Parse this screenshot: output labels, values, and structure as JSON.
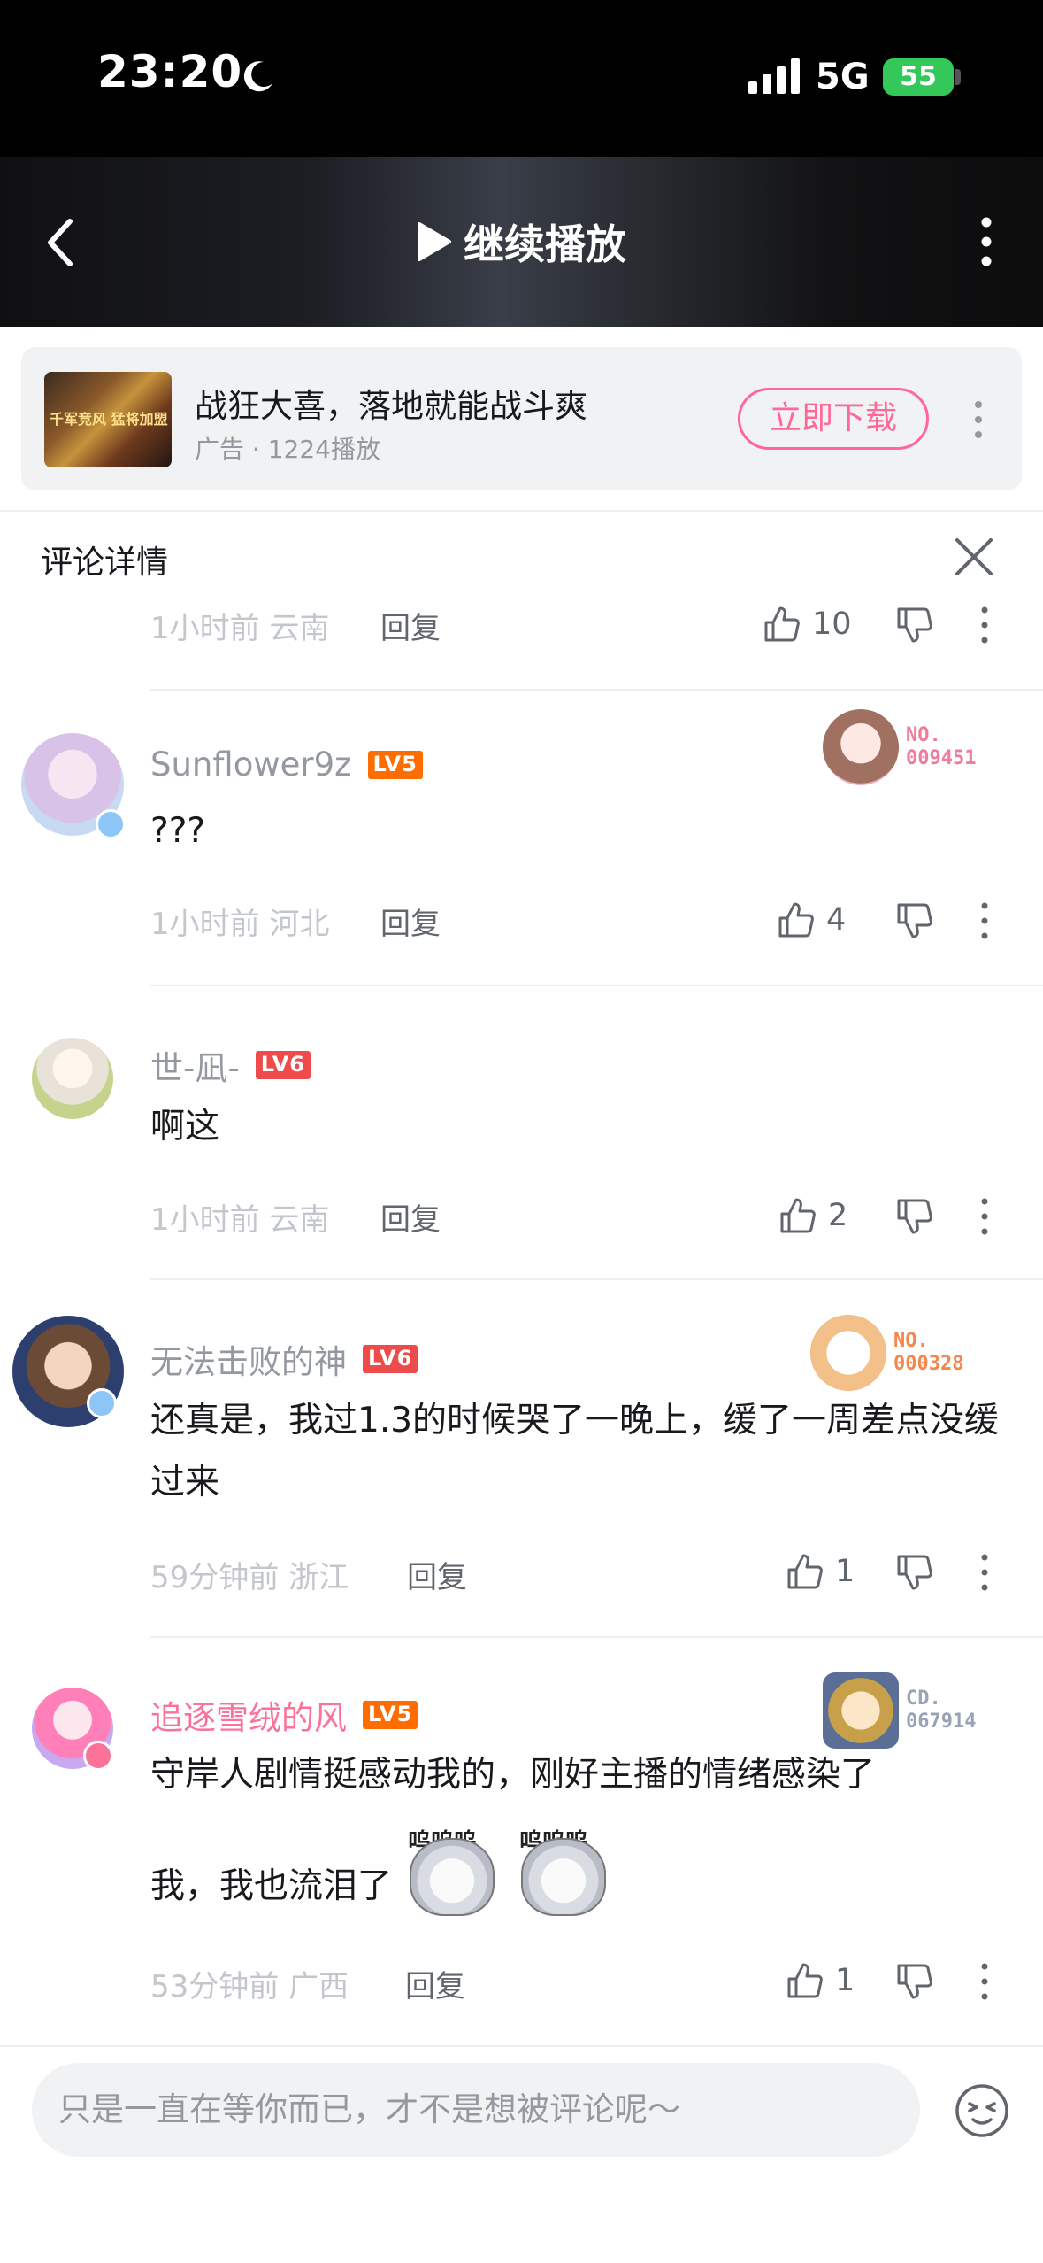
{
  "status_bar": {
    "time": "23:20",
    "network": "5G",
    "battery": "55"
  },
  "player": {
    "continue_label": "继续播放"
  },
  "ad": {
    "title": "战狂大喜，落地就能战斗爽",
    "meta": "广告 · 1224播放",
    "download_label": "立即下载",
    "thumb_text": "千军竞风 猛将加盟"
  },
  "detail": {
    "title": "评论详情"
  },
  "top_row": {
    "meta": "1小时前  云南",
    "reply": "回复",
    "likes": "10"
  },
  "comments": [
    {
      "username": "Sunflower9z",
      "level": "LV5",
      "text": "???",
      "meta": "1小时前  河北",
      "reply": "回复",
      "likes": "4",
      "fan_no": "NO.",
      "fan_id": "009451",
      "fan_color": "#f07c9c"
    },
    {
      "username": "世-凪-",
      "level": "LV6",
      "text": "啊这",
      "meta": "1小时前  云南",
      "reply": "回复",
      "likes": "2"
    },
    {
      "username": "无法击败的神",
      "level": "LV6",
      "text": "还真是，我过1.3的时候哭了一晚上，缓了一周差点没缓过来",
      "meta": "59分钟前  浙江",
      "reply": "回复",
      "likes": "1",
      "fan_no": "NO.",
      "fan_id": "000328",
      "fan_color": "#f5874a"
    },
    {
      "username": "追逐雪绒的风",
      "level": "LV5",
      "text_line1": "守岸人剧情挺感动我的，刚好主播的情绪感染了",
      "text_line2": "我，我也流泪了",
      "emote_caption": "呜呜呜",
      "meta": "53分钟前  广西",
      "reply": "回复",
      "likes": "1",
      "fan_no": "CD.",
      "fan_id": "067914",
      "fan_color": "#9aa3b5"
    }
  ],
  "input": {
    "placeholder": "只是一直在等你而已，才不是想被评论呢～"
  },
  "colors": {
    "accent": "#fb7299",
    "download": "#ff6699",
    "lv5": "#ff6c00",
    "lv6": "#ee4c4c",
    "battery": "#34c759"
  },
  "icons": [
    "back-arrow-icon",
    "play-icon",
    "more-vertical-icon",
    "close-icon",
    "thumb-up-icon",
    "thumb-down-icon",
    "emoji-icon",
    "moon-icon",
    "signal-icon"
  ]
}
